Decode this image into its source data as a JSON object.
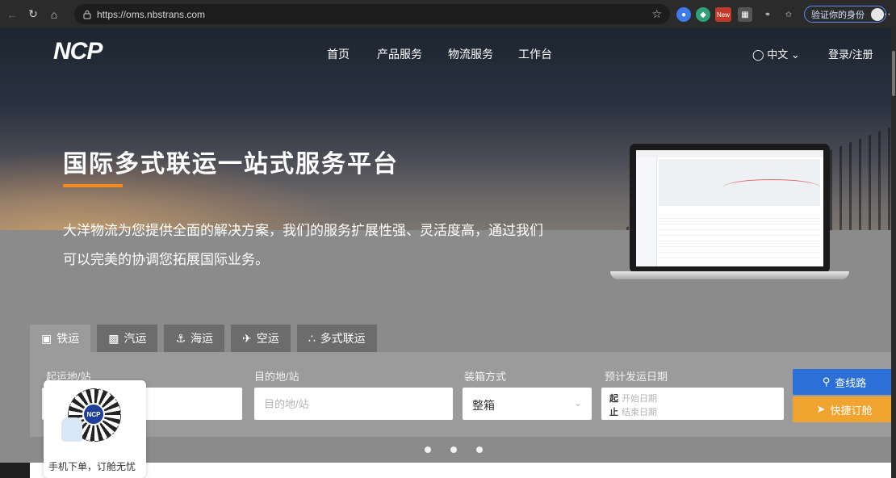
{
  "browser": {
    "url": "https://oms.nbstrans.com",
    "verify_label": "验证你的身份",
    "ext_new_label": "New"
  },
  "site": {
    "logo": "NCP",
    "nav": [
      "首页",
      "产品服务",
      "物流服务",
      "工作台"
    ],
    "language": "中文",
    "login": "登录/注册"
  },
  "hero": {
    "headline": "国际多式联运一站式服务平台",
    "desc_line1": "大洋物流为您提供全面的解决方案，我们的服务扩展性强、灵活度高，通过我们",
    "desc_line2": "可以完美的协调您拓展国际业务。"
  },
  "tabs": [
    {
      "label": "铁运",
      "active": true
    },
    {
      "label": "汽运",
      "active": false
    },
    {
      "label": "海运",
      "active": false
    },
    {
      "label": "空运",
      "active": false
    },
    {
      "label": "多式联运",
      "active": false
    }
  ],
  "search": {
    "origin_label": "起运地/站",
    "origin_placeholder": "起运地/站",
    "dest_label": "目的地/站",
    "dest_placeholder": "目的地/站",
    "packing_label": "装箱方式",
    "packing_value": "整箱",
    "date_label": "预计发运日期",
    "date_start_prefix": "起",
    "date_start_placeholder": "开始日期",
    "date_end_prefix": "止",
    "date_end_placeholder": "结束日期",
    "find_route_label": "查线路",
    "quick_book_label": "快捷订舱"
  },
  "qr_widget": {
    "caption": "手机下单，订舱无忧",
    "logo": "NCP"
  },
  "colors": {
    "accent_orange": "#f08c1e",
    "button_blue": "#2c6fd6",
    "button_orange": "#f0a32e"
  }
}
